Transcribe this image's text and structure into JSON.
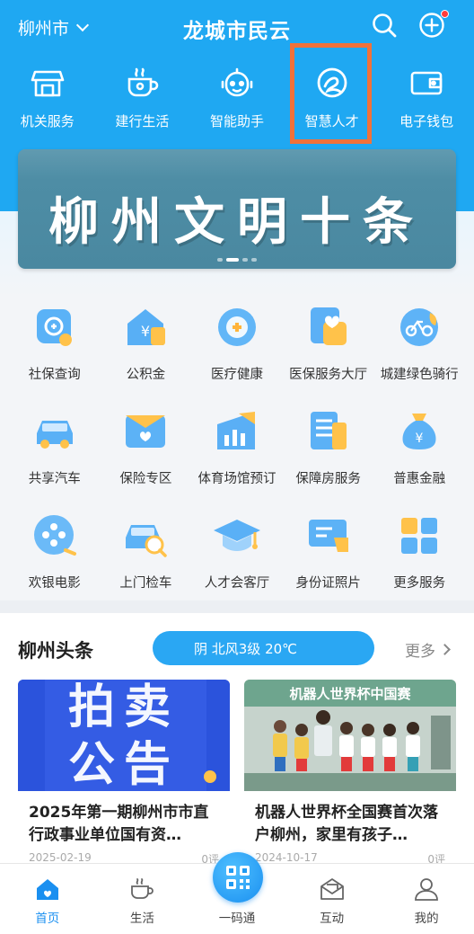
{
  "header": {
    "city": "柳州市",
    "title": "龙城市民云"
  },
  "quick_services": [
    {
      "label": "机关服务",
      "icon": "storefront-icon"
    },
    {
      "label": "建行生活",
      "icon": "coffee-cup-icon"
    },
    {
      "label": "智能助手",
      "icon": "robot-face-icon"
    },
    {
      "label": "智慧人才",
      "icon": "talent-logo-icon"
    },
    {
      "label": "电子钱包",
      "icon": "wallet-icon"
    }
  ],
  "banner": {
    "text": "柳州文明十条",
    "dots": 4,
    "active_dot": 1
  },
  "services": [
    {
      "label": "社保查询",
      "icon": "social-security-icon"
    },
    {
      "label": "公积金",
      "icon": "housing-fund-icon"
    },
    {
      "label": "医疗健康",
      "icon": "medical-health-icon"
    },
    {
      "label": "医保服务大厅",
      "icon": "medical-insurance-icon"
    },
    {
      "label": "城建绿色骑行",
      "icon": "green-cycling-icon"
    },
    {
      "label": "共享汽车",
      "icon": "car-sharing-icon"
    },
    {
      "label": "保险专区",
      "icon": "insurance-icon"
    },
    {
      "label": "体育场馆预订",
      "icon": "sports-venue-icon"
    },
    {
      "label": "保障房服务",
      "icon": "affordable-housing-icon"
    },
    {
      "label": "普惠金融",
      "icon": "money-bag-icon"
    },
    {
      "label": "欢银电影",
      "icon": "film-reel-icon"
    },
    {
      "label": "上门检车",
      "icon": "car-inspection-icon"
    },
    {
      "label": "人才会客厅",
      "icon": "graduation-cap-icon"
    },
    {
      "label": "身份证照片",
      "icon": "id-photo-icon"
    },
    {
      "label": "更多服务",
      "icon": "more-grid-icon"
    }
  ],
  "headlines": {
    "title": "柳州头条",
    "weather": "阴 北风3级 20℃",
    "more_label": "更多",
    "cards": [
      {
        "image_text": "拍卖公告",
        "title": "2025年第一期柳州市市直行政事业单位国有资…",
        "date": "2025-02-19",
        "count": "0评"
      },
      {
        "image_text": "机器人世界杯中国赛",
        "title": "机器人世界杯全国赛首次落户柳州，家里有孩子…",
        "date": "2024-10-17",
        "count": "0评"
      }
    ]
  },
  "tabbar": [
    {
      "label": "首页",
      "icon": "home-icon",
      "active": true
    },
    {
      "label": "生活",
      "icon": "coffee-cup-icon",
      "active": false
    },
    {
      "label": "一码通",
      "icon": "qr-code-icon",
      "active": false
    },
    {
      "label": "互动",
      "icon": "mail-icon",
      "active": false
    },
    {
      "label": "我的",
      "icon": "user-icon",
      "active": false
    }
  ],
  "colors": {
    "brand_blue": "#1fa8f2",
    "highlight_orange": "#f0713a",
    "active_tab": "#1a8ff0"
  }
}
